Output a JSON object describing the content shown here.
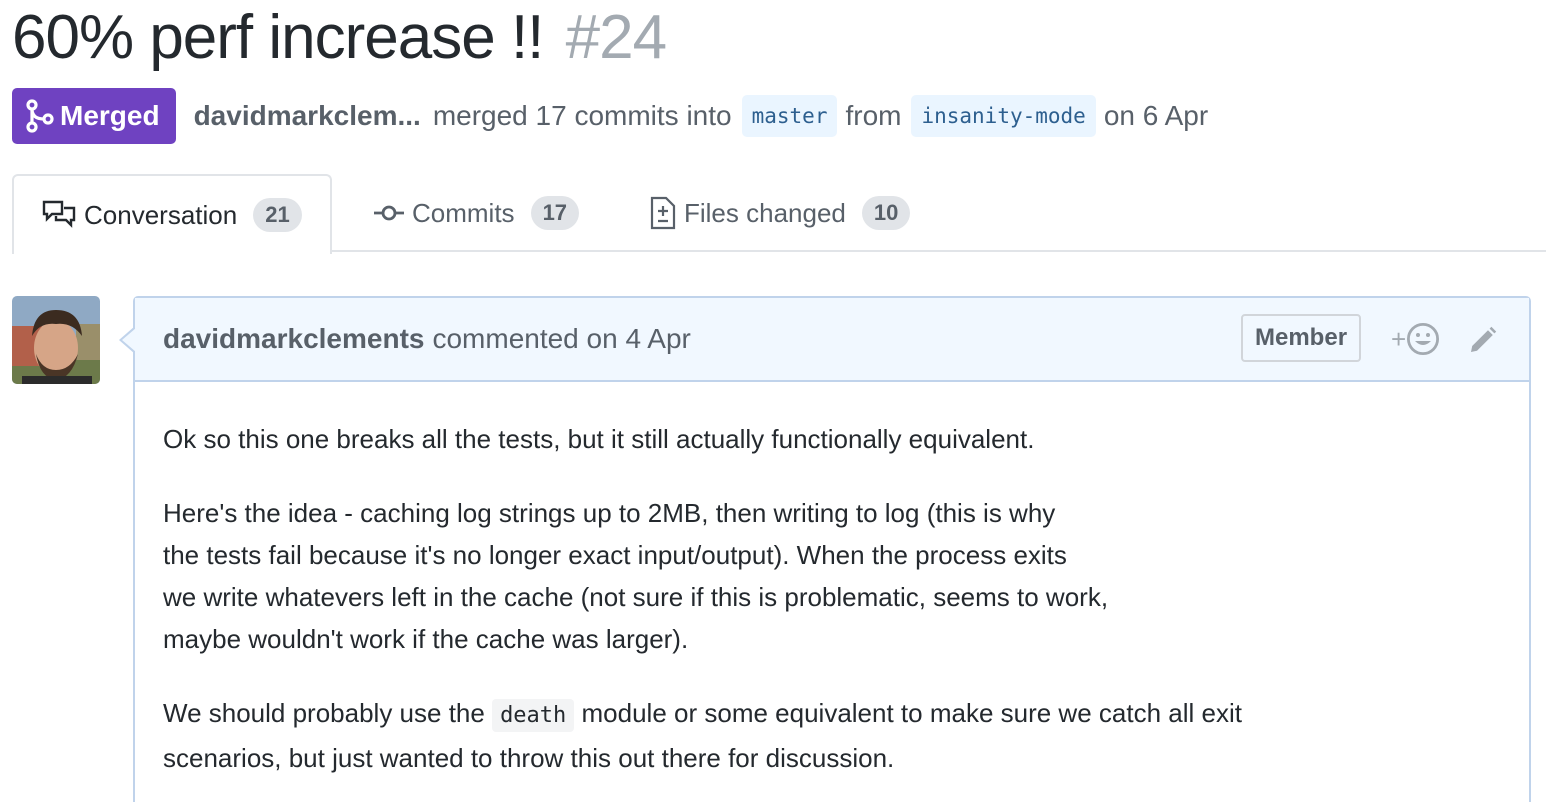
{
  "pr": {
    "title": "60% perf increase !!",
    "number": "#24",
    "state": "Merged",
    "author": "davidmarkclem...",
    "merged_text": "merged 17 commits into",
    "base_branch": "master",
    "from_text": "from",
    "head_branch": "insanity-mode",
    "date_text": "on 6 Apr"
  },
  "tabs": [
    {
      "label": "Conversation",
      "count": "21",
      "icon": "comment-discussion-icon",
      "selected": true
    },
    {
      "label": "Commits",
      "count": "17",
      "icon": "git-commit-icon",
      "selected": false
    },
    {
      "label": "Files changed",
      "count": "10",
      "icon": "diff-icon",
      "selected": false
    }
  ],
  "comment": {
    "author": "davidmarkclements",
    "action": "commented on 4 Apr",
    "role": "Member",
    "reaction_plus": "+",
    "para1": "Ok so this one breaks all the tests, but it still actually functionally equivalent.",
    "para2_lines": [
      "Here's the idea - caching log strings up to 2MB, then writing to log (this is why",
      "the tests fail because it's no longer exact input/output). When the process exits",
      "we write whatevers left in the cache (not sure if this is problematic, seems to work,",
      "maybe wouldn't work if the cache was larger)."
    ],
    "para3_before": "We should probably use the ",
    "para3_code": "death",
    "para3_after": " module or some equivalent to make sure we catch all exit",
    "para3_line2": "scenarios, but just wanted to throw this out there for discussion."
  },
  "colors": {
    "merged_purple": "#6f42c1",
    "header_bg": "#f1f8ff",
    "header_border": "#c0d3eb"
  }
}
